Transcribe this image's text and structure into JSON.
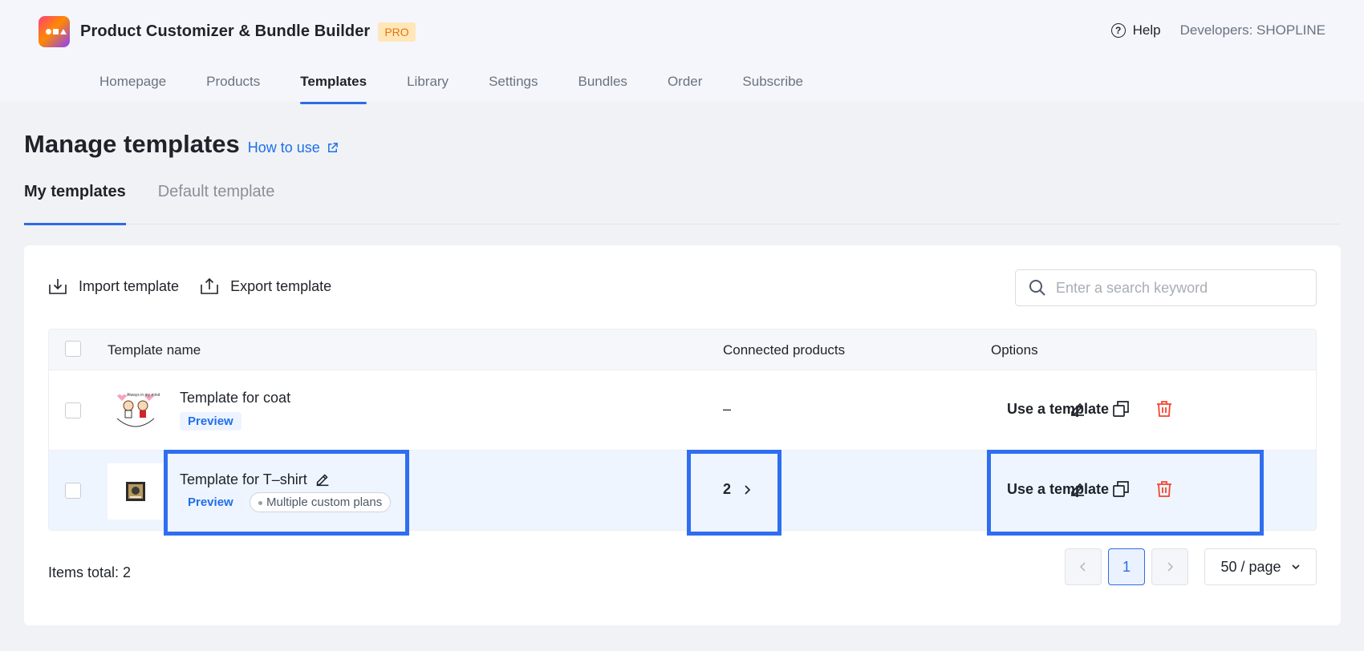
{
  "app": {
    "title": "Product Customizer & Bundle Builder",
    "badge": "PRO"
  },
  "header": {
    "help_label": "Help",
    "developer_label": "Developers: SHOPLINE"
  },
  "nav": {
    "tabs": [
      {
        "label": "Homepage"
      },
      {
        "label": "Products"
      },
      {
        "label": "Templates",
        "active": true
      },
      {
        "label": "Library"
      },
      {
        "label": "Settings"
      },
      {
        "label": "Bundles"
      },
      {
        "label": "Order"
      },
      {
        "label": "Subscribe"
      }
    ]
  },
  "page": {
    "title": "Manage templates",
    "how_to_use": "How to use"
  },
  "sub_tabs": [
    {
      "label": "My templates",
      "active": true
    },
    {
      "label": "Default template"
    }
  ],
  "toolbar": {
    "import_label": "Import template",
    "export_label": "Export template"
  },
  "search": {
    "placeholder": "Enter a search keyword",
    "value": ""
  },
  "table": {
    "headers": {
      "name": "Template name",
      "connected": "Connected products",
      "options": "Options"
    },
    "rows": [
      {
        "name": "Template for coat",
        "preview": "Preview",
        "plan_tag": "",
        "connected": "–",
        "use_label": "Use a template"
      },
      {
        "name": "Template for T–shirt",
        "preview": "Preview",
        "plan_tag": "Multiple custom plans",
        "connected": "2",
        "use_label": "Use a template"
      }
    ]
  },
  "footer": {
    "total": "Items total: 2"
  },
  "pagination": {
    "current_page": "1",
    "page_size": "50 / page"
  },
  "colors": {
    "accent": "#2e6be6",
    "highlight_border": "#2f6ef0",
    "delete": "#f5442d",
    "link": "#1e6fe8"
  }
}
